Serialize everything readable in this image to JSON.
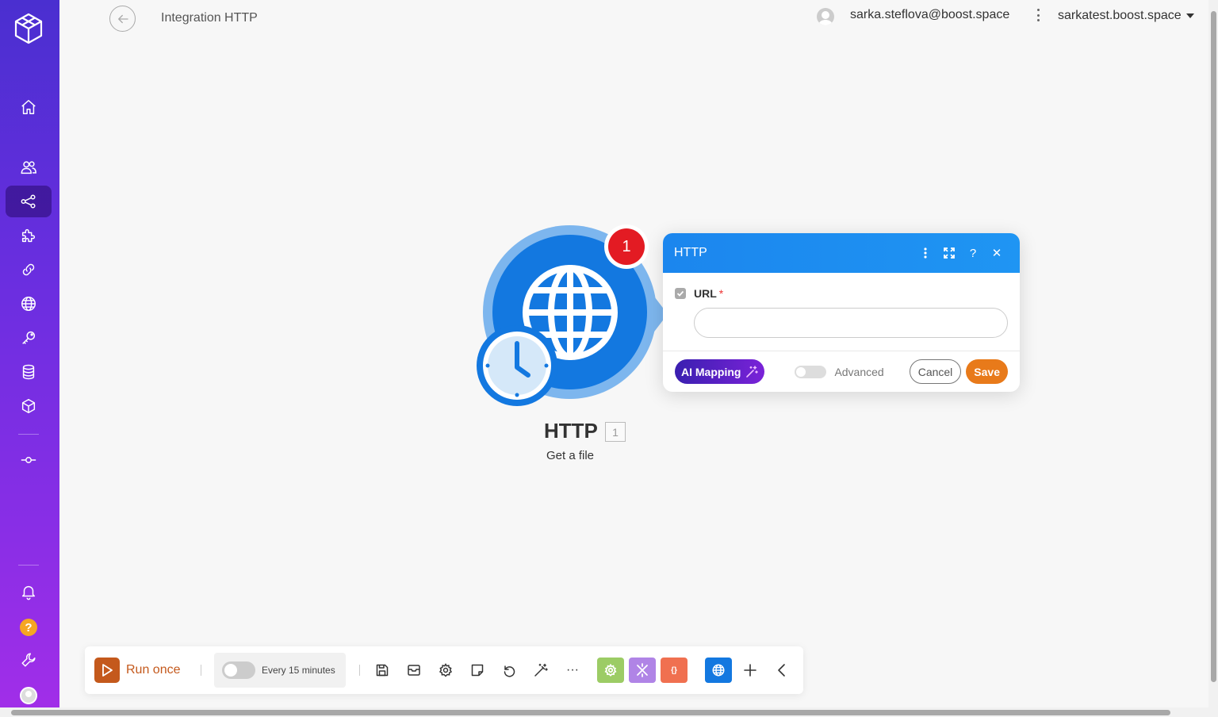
{
  "header": {
    "back_label": "back",
    "title": "Integration HTTP",
    "user_email": "sarka.steflova@boost.space",
    "organization": "sarkatest.boost.space"
  },
  "sidebar": {
    "items": [
      "home-icon",
      "users-icon",
      "share-nodes-icon",
      "puzzle-icon",
      "link-icon",
      "globe-icon",
      "key-icon",
      "database-icon",
      "cube-icon",
      "commit-icon"
    ],
    "bottom": [
      "bell-icon",
      "help-icon",
      "wrench-icon",
      "avatar"
    ],
    "help_label": "?"
  },
  "module": {
    "name": "HTTP",
    "number": "1",
    "subtitle": "Get a file",
    "badge": "1",
    "color": "#1378e0"
  },
  "dialog": {
    "title": "HTTP",
    "url_label": "URL",
    "required_mark": "*",
    "url_value": "",
    "ai_mapping_label": "AI Mapping",
    "advanced_label": "Advanced",
    "cancel_label": "Cancel",
    "save_label": "Save",
    "help_label": "?",
    "close_label": "✕"
  },
  "toolbar": {
    "run_label": "Run once",
    "schedule_label": "Every 15 minutes",
    "more_label": "···",
    "tools_text_label": "{}",
    "colors": {
      "run": "#c4591c",
      "tools": "#9ccc65",
      "flow": "#b084e6",
      "text": "#f07050",
      "http": "#1378e0"
    }
  }
}
